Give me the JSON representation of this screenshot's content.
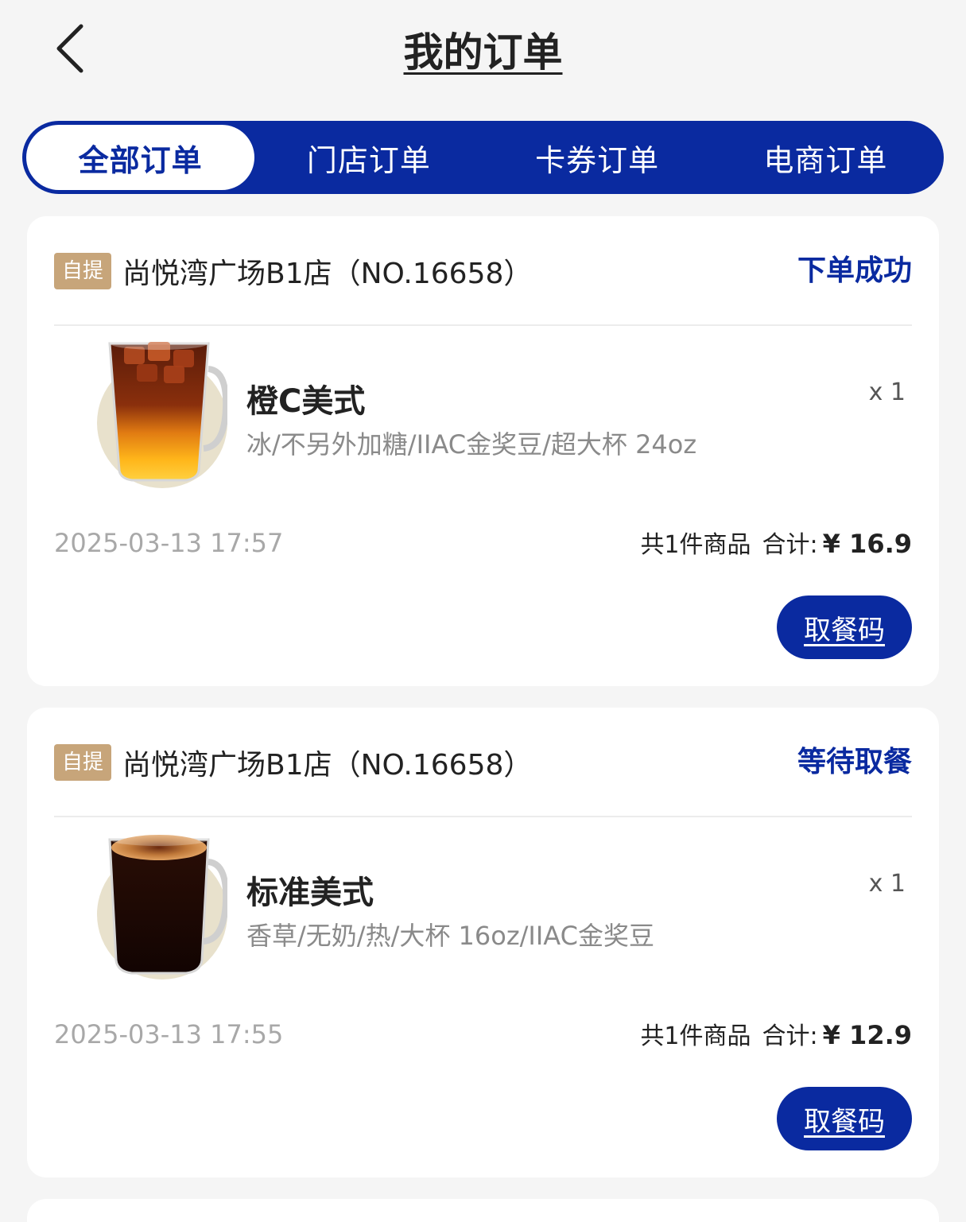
{
  "header": {
    "title": "我的订单"
  },
  "tabs": [
    {
      "label": "全部订单",
      "active": true
    },
    {
      "label": "门店订单",
      "active": false
    },
    {
      "label": "卡券订单",
      "active": false
    },
    {
      "label": "电商订单",
      "active": false
    }
  ],
  "orders": [
    {
      "pickup_badge": "自提",
      "store": "尚悦湾广场B1店（NO.16658）",
      "status": "下单成功",
      "product": {
        "name": "橙C美式",
        "spec": "冰/不另外加糖/IIAC金奖豆/超大杯 24oz",
        "qty": "x 1"
      },
      "time": "2025-03-13 17:57",
      "count_text": "共1件商品",
      "total_label": "合计:",
      "total_amount": "¥ 16.9",
      "action": "取餐码"
    },
    {
      "pickup_badge": "自提",
      "store": "尚悦湾广场B1店（NO.16658）",
      "status": "等待取餐",
      "product": {
        "name": "标准美式",
        "spec": "香草/无奶/热/大杯 16oz/IIAC金奖豆",
        "qty": "x 1"
      },
      "time": "2025-03-13 17:55",
      "count_text": "共1件商品",
      "total_label": "合计:",
      "total_amount": "¥ 12.9",
      "action": "取餐码"
    }
  ],
  "colors": {
    "brand_blue": "#0a2aa0",
    "badge_tan": "#c7a57a",
    "background": "#f5f5f5"
  },
  "icons": {
    "back": "chevron-left-icon"
  }
}
